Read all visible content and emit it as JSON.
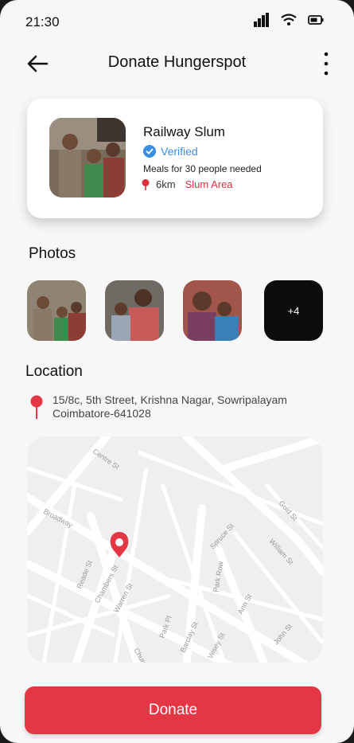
{
  "status_bar": {
    "time": "21:30"
  },
  "header": {
    "title": "Donate Hungerspot"
  },
  "spot": {
    "name": "Railway Slum",
    "verified_label": "Verified",
    "need": "Meals for 30 people needed",
    "distance": "6km",
    "area": "Slum Area"
  },
  "photos": {
    "heading": "Photos",
    "more_label": "+4"
  },
  "location": {
    "heading": "Location",
    "address_line1": "15/8c, 5th Street, Krishna Nagar, Sowripalayam",
    "address_line2": "Coimbatore-641028"
  },
  "map": {
    "streets": [
      "Centre St",
      "Broadway",
      "Reade St",
      "Chambers St",
      "Warren St",
      "Church St",
      "Park Pl",
      "Barclay St",
      "Vesey St",
      "Park Row",
      "Spruce St",
      "Ann St",
      "John St",
      "William St",
      "Gold St"
    ]
  },
  "action": {
    "donate_label": "Donate"
  },
  "colors": {
    "accent": "#e53645",
    "verified": "#3a8ee6",
    "area": "#e03040"
  }
}
